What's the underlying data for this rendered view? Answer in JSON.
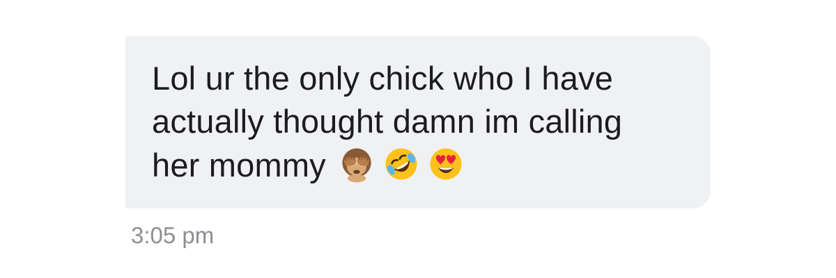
{
  "message": {
    "lines": [
      "Lol ur the only chick who I have",
      "actually thought damn im calling",
      "her mommy"
    ],
    "emojis": [
      "see-no-evil-monkey",
      "rolling-on-floor-laughing",
      "smiling-face-with-heart-eyes"
    ],
    "timestamp": "3:05 pm"
  },
  "colors": {
    "bubble_background": "#f0f1f3",
    "message_text": "#1c1c1e",
    "timestamp_text": "#8e8e93",
    "page_background": "#ffffff"
  }
}
